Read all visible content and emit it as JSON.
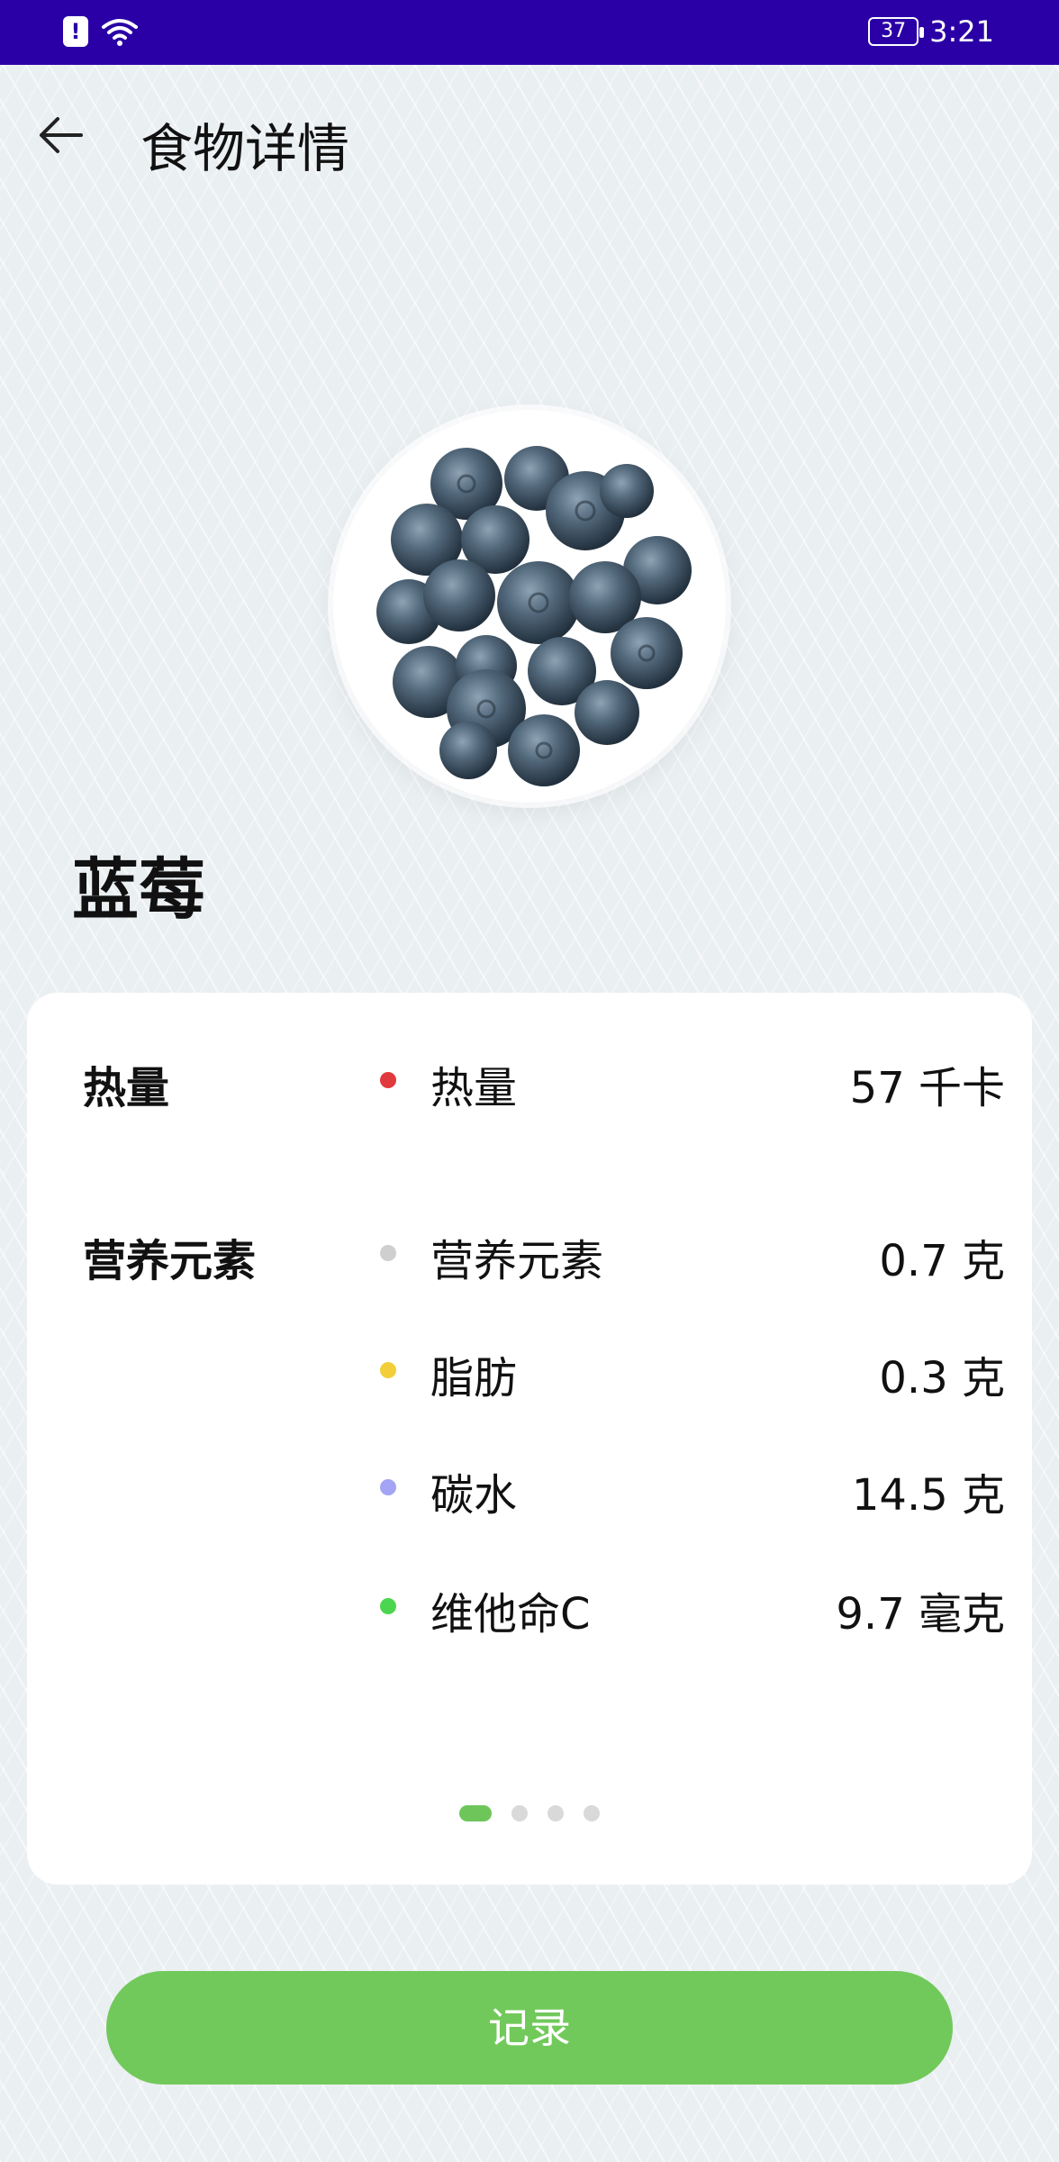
{
  "status_bar": {
    "time": "3:21",
    "battery": "37",
    "icons": [
      "alert-icon",
      "wifi-icon",
      "battery-icon"
    ]
  },
  "header": {
    "title": "食物详情",
    "back_icon": "arrow-left-icon"
  },
  "food": {
    "name": "蓝莓",
    "image": "blueberry-bowl-photo"
  },
  "nutrition": {
    "calorie_group": {
      "title": "热量",
      "rows": [
        {
          "label": "热量",
          "value": "57 千卡",
          "dot_color": "#e0393e"
        }
      ]
    },
    "nutrient_group": {
      "title": "营养元素",
      "rows": [
        {
          "label": "营养元素",
          "value": "0.7 克",
          "dot_color": "#cfcfcf"
        },
        {
          "label": "脂肪",
          "value": "0.3 克",
          "dot_color": "#f2cf3a"
        },
        {
          "label": "碳水",
          "value": "14.5 克",
          "dot_color": "#a3a4f4"
        },
        {
          "label": "维他命C",
          "value": "9.7 毫克",
          "dot_color": "#4cd64f"
        }
      ]
    },
    "pager": {
      "count": 4,
      "active": 0
    }
  },
  "actions": {
    "record_label": "记录"
  },
  "colors": {
    "status_bar": "#2a00a6",
    "accent": "#72c95b"
  }
}
